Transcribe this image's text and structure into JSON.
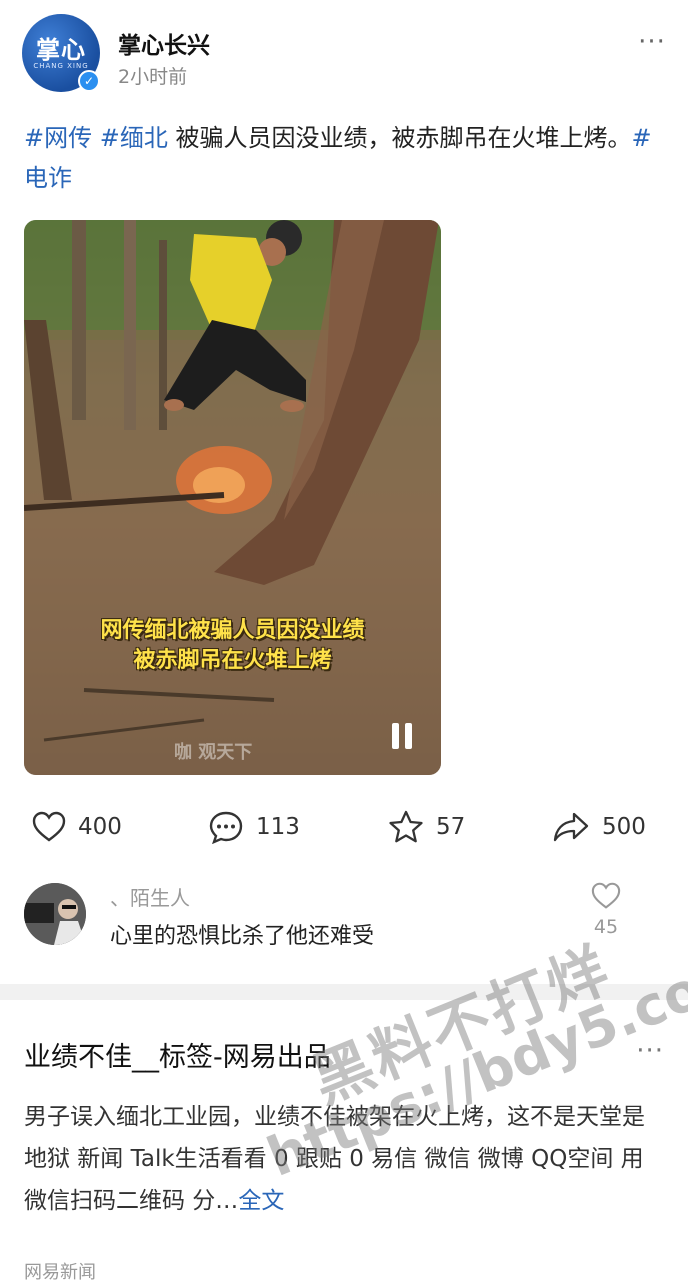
{
  "post": {
    "author": "掌心长兴",
    "avatar_logo": "掌心",
    "avatar_logo_sub": "CHANG XING",
    "time": "2小时前",
    "more": "···",
    "hashtags": [
      "#网传",
      "#缅北",
      "#电诈"
    ],
    "text_part1": " 被骗人员因没业绩，被赤脚吊在火堆上烤。",
    "video": {
      "caption_line1": "网传缅北被骗人员因没业绩",
      "caption_line2": "被赤脚吊在火堆上烤",
      "watermark": "咖 观天下",
      "state": "playing"
    }
  },
  "actions": {
    "like": "400",
    "comment": "113",
    "favorite": "57",
    "share": "500"
  },
  "top_comment": {
    "user": "、陌生人",
    "text": "心里的恐惧比杀了他还难受",
    "likes": "45"
  },
  "article": {
    "title": "业绩不佳__标签-网易出品",
    "more": "···",
    "body": "男子误入缅北工业园，业绩不佳被架在火上烤，这不是天堂是地狱 新闻 Talk生活看看 0 跟贴 0 易信 微信 微博 QQ空间 用微信扫码二维码 分…",
    "read_more": "全文",
    "source": "网易新闻"
  },
  "overlay_watermark": {
    "line1": "黑料不打烊",
    "line2": "https://bdy5.co"
  },
  "colors": {
    "link": "#2a66b8",
    "accent": "#2b8ff0"
  }
}
